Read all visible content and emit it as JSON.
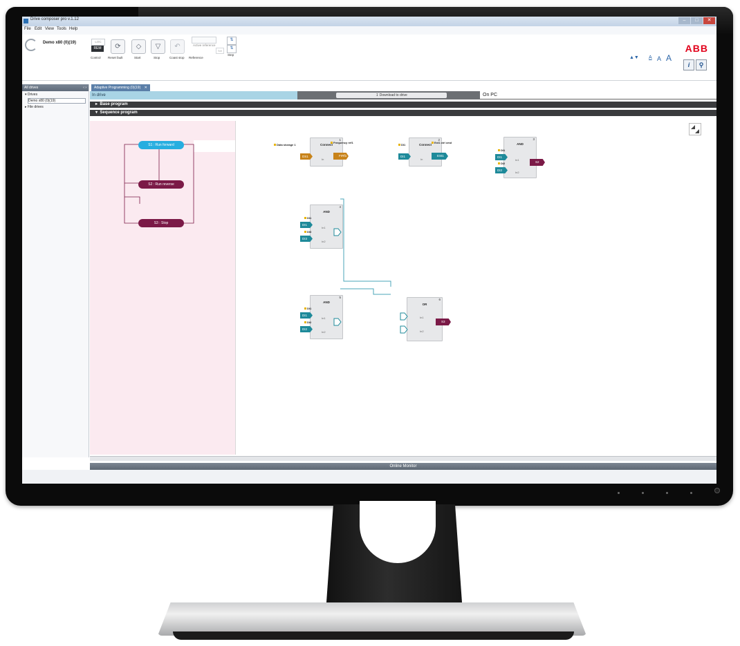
{
  "window": {
    "title": "Drive composer pro v.1.12",
    "menu": [
      "File",
      "Edit",
      "View",
      "Tools",
      "Help"
    ],
    "controls": [
      "–",
      "□",
      "✕"
    ]
  },
  "toolbar": {
    "drive_name": "Demo x80 (0)(19)",
    "loc_label": "LOC",
    "rem_label": "REM",
    "control_label": "Control",
    "reset_fault_label": "Reset fault",
    "start_label": "Start",
    "stop_label": "Stop",
    "coast_stop_label": "Coast stop",
    "reference_label": "Reference",
    "active_reference_label": "Active reference",
    "set_label": "Set",
    "step_label": "Step",
    "font_controls": [
      "▲▼",
      "A",
      "A",
      "A"
    ],
    "brand": "ABB"
  },
  "sidebar": {
    "header": "All drives",
    "items": [
      {
        "label": "Drives"
      },
      {
        "label": "Demo x80 (0)(19)"
      },
      {
        "label": "File drives"
      }
    ]
  },
  "main": {
    "tab_label": "Adaptive Programming (0)(19)",
    "status_in_drive": "In drive",
    "download_button": "Download to drive",
    "status_on_pc": "On PC",
    "base_program": "Base program",
    "sequence_program": "Sequence program"
  },
  "states": [
    {
      "label": "S1 : Run forward",
      "color": "#27aee0"
    },
    {
      "label": "S2 : Run reverse",
      "color": "#7b1a47"
    },
    {
      "label": "S3 : Stop",
      "color": "#7b1a47"
    }
  ],
  "blocks": [
    {
      "num": "1",
      "title": "Connect",
      "inputs": [
        "DS1"
      ],
      "port": "In",
      "output": "FrRf1",
      "param_in": "Data storage 1",
      "param_out": "Frequency ref1",
      "out_color": "#c8831a",
      "in_color": "#c8831a"
    },
    {
      "num": "2",
      "title": "Connect",
      "inputs": [
        "DI1"
      ],
      "port": "In",
      "output": "ESt1",
      "param_in": "DI1",
      "param_out": "Ext1 ctrl cmd",
      "out_color": "#1e8a9a",
      "in_color": "#1e8a9a"
    },
    {
      "num": "3",
      "title": "AND",
      "inputs": [
        "DI1",
        "DI2"
      ],
      "ports": [
        "In1",
        "In2"
      ],
      "output": "S2",
      "params": [
        "DI1",
        "DI2"
      ],
      "out_color": "#7b1a47"
    },
    {
      "num": "4",
      "title": "AND",
      "inputs": [
        "DI1",
        "DI3"
      ],
      "ports": [
        "In1",
        "In2"
      ],
      "params": [
        "DI1",
        "DI3"
      ]
    },
    {
      "num": "5",
      "title": "AND",
      "inputs": [
        "DI1",
        "DI2"
      ],
      "ports": [
        "In1",
        "In2"
      ],
      "params": [
        "DI1",
        "DI2"
      ]
    },
    {
      "num": "6",
      "title": "OR",
      "ports": [
        "In1",
        "In2"
      ],
      "output": "S3",
      "out_color": "#7b1a47"
    }
  ],
  "monitor_bar": "Online Monitor",
  "colors": {
    "accent": "#5b7fa8",
    "teal": "#1e8a9a",
    "maroon": "#7b1a47",
    "cyan_state": "#27aee0",
    "orange": "#c8831a",
    "brand_red": "#e2001a"
  }
}
